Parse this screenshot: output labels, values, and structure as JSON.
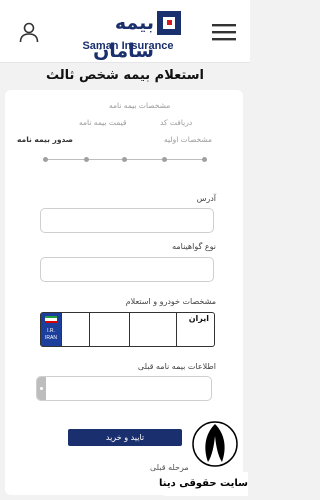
{
  "header": {
    "logo_fa": "بیمه سامان",
    "logo_en": "Saman Insurance",
    "colors": {
      "brand": "#1a2f6d",
      "accent": "#d71920"
    }
  },
  "page": {
    "title": "استعلام بیمه شخص ثالث"
  },
  "steps": [
    {
      "label": "مشخصات بیمه نامه"
    },
    {
      "label": "دریافت کد"
    },
    {
      "label": "قیمت بیمه نامه"
    },
    {
      "label": "مشخصات اولیه"
    },
    {
      "label": "صدور بیمه نامه"
    }
  ],
  "form": {
    "address_label": "آدرس",
    "address_value": "",
    "certificate_label": "نوع گواهینامه",
    "certificate_value": "",
    "vehicle_label": "مشخصات خودرو و استعلام",
    "plate": {
      "country_code": "I.R. IRAN",
      "iran_label": "ایران"
    },
    "prev_policy_label": "اطلاعات بیمه نامه قبلی",
    "prev_policy_value": ""
  },
  "actions": {
    "submit_label": "تایید و خرید",
    "prev_step_label": "مرحله قبلی"
  },
  "watermark": {
    "text": "سایت حقوقی دینا"
  }
}
